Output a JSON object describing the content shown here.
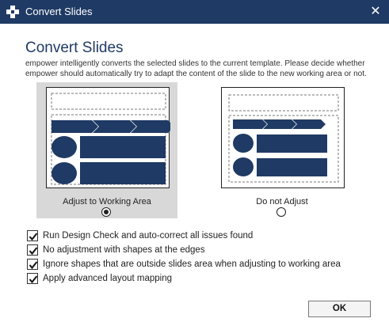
{
  "window": {
    "title": "Convert Slides",
    "close_glyph": "✕",
    "title_color": "#1f3a64"
  },
  "main": {
    "heading": "Convert Slides",
    "description": "empower intelligently converts the selected slides to the current template. Please decide whether empower should automatically try to adapt the content of the slide to the new working area or not."
  },
  "options": [
    {
      "label": "Adjust to Working Area",
      "selected": true
    },
    {
      "label": "Do not Adjust",
      "selected": false
    }
  ],
  "checkboxes": [
    {
      "label": "Run Design Check and auto-correct all issues found",
      "checked": true
    },
    {
      "label": "No adjustment with shapes at the edges",
      "checked": true
    },
    {
      "label": "Ignore shapes that are outside slides area when adjusting to working area",
      "checked": true
    },
    {
      "label": "Apply advanced layout mapping",
      "checked": true
    }
  ],
  "footer": {
    "ok_label": "OK"
  },
  "colors": {
    "accent": "#1f3a64",
    "selected_bg": "#d8d8d8"
  }
}
